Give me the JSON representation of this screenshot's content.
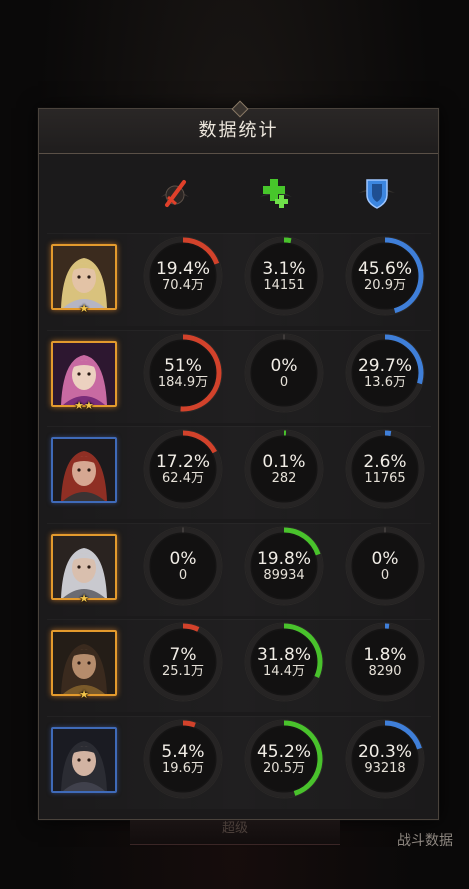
{
  "title": "数据统计",
  "footer_tab_label": "超级",
  "corner_label": "战斗数据",
  "columns": [
    {
      "name": "damage",
      "icon": "red-sword-icon",
      "color": "#d2422b"
    },
    {
      "name": "heal",
      "icon": "green-cross-icon",
      "color": "#49c22c"
    },
    {
      "name": "shield",
      "icon": "blue-shield-icon",
      "color": "#3f7fd9"
    }
  ],
  "rows": [
    {
      "hero": "blonde-eyepatch-hero",
      "frame": "gold",
      "stars": "★",
      "stats": [
        {
          "pct": "19.4%",
          "value": "70.4万",
          "fill": 0.194
        },
        {
          "pct": "3.1%",
          "value": "14151",
          "fill": 0.031
        },
        {
          "pct": "45.6%",
          "value": "20.9万",
          "fill": 0.456
        }
      ]
    },
    {
      "hero": "purple-hat-hero",
      "frame": "gold",
      "stars": "★★",
      "stats": [
        {
          "pct": "51%",
          "value": "184.9万",
          "fill": 0.51
        },
        {
          "pct": "0%",
          "value": "0",
          "fill": 0
        },
        {
          "pct": "29.7%",
          "value": "13.6万",
          "fill": 0.297
        }
      ]
    },
    {
      "hero": "red-hooded-hero",
      "frame": "blue",
      "stars": "",
      "stats": [
        {
          "pct": "17.2%",
          "value": "62.4万",
          "fill": 0.172
        },
        {
          "pct": "0.1%",
          "value": "282",
          "fill": 0.001
        },
        {
          "pct": "2.6%",
          "value": "11765",
          "fill": 0.026
        }
      ]
    },
    {
      "hero": "silver-hair-hero",
      "frame": "gold",
      "stars": "★",
      "stats": [
        {
          "pct": "0%",
          "value": "0",
          "fill": 0
        },
        {
          "pct": "19.8%",
          "value": "89934",
          "fill": 0.198
        },
        {
          "pct": "0%",
          "value": "0",
          "fill": 0
        }
      ]
    },
    {
      "hero": "bearded-warrior-hero",
      "frame": "gold",
      "stars": "★",
      "stats": [
        {
          "pct": "7%",
          "value": "25.1万",
          "fill": 0.07
        },
        {
          "pct": "31.8%",
          "value": "14.4万",
          "fill": 0.318
        },
        {
          "pct": "1.8%",
          "value": "8290",
          "fill": 0.018
        }
      ]
    },
    {
      "hero": "dark-hooded-hero",
      "frame": "blue",
      "stars": "",
      "stats": [
        {
          "pct": "5.4%",
          "value": "19.6万",
          "fill": 0.054
        },
        {
          "pct": "45.2%",
          "value": "20.5万",
          "fill": 0.452
        },
        {
          "pct": "20.3%",
          "value": "93218",
          "fill": 0.203
        }
      ]
    }
  ]
}
